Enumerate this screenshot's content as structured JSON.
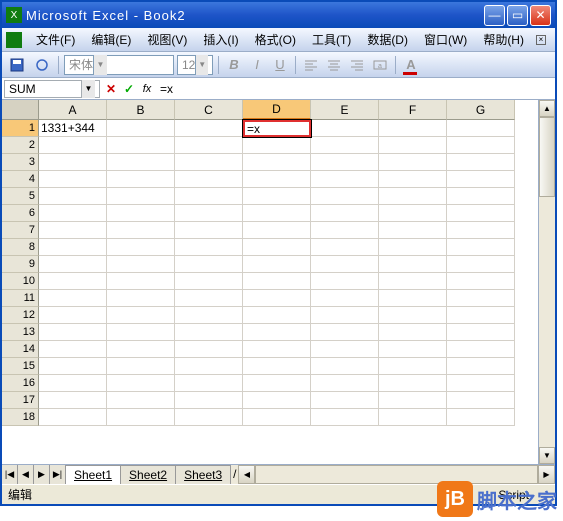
{
  "window": {
    "title": "Microsoft Excel - Book2"
  },
  "menu": {
    "items": [
      "文件(F)",
      "编辑(E)",
      "视图(V)",
      "插入(I)",
      "格式(O)",
      "工具(T)",
      "数据(D)",
      "窗口(W)",
      "帮助(H)"
    ]
  },
  "toolbar": {
    "font": "宋体",
    "size": "12"
  },
  "formula_bar": {
    "name_box": "SUM",
    "formula": "=x"
  },
  "columns": [
    "A",
    "B",
    "C",
    "D",
    "E",
    "F",
    "G"
  ],
  "rows_visible": 18,
  "active_col": "D",
  "active_row": 1,
  "active_col_index": 3,
  "cells": {
    "A1": "1331+344",
    "D1": "=x"
  },
  "sheets": [
    "Sheet1",
    "Sheet2",
    "Sheet3"
  ],
  "status": {
    "left": "编辑",
    "right": "Script"
  },
  "watermark": {
    "logo": "jB",
    "text": "脚本之家"
  }
}
